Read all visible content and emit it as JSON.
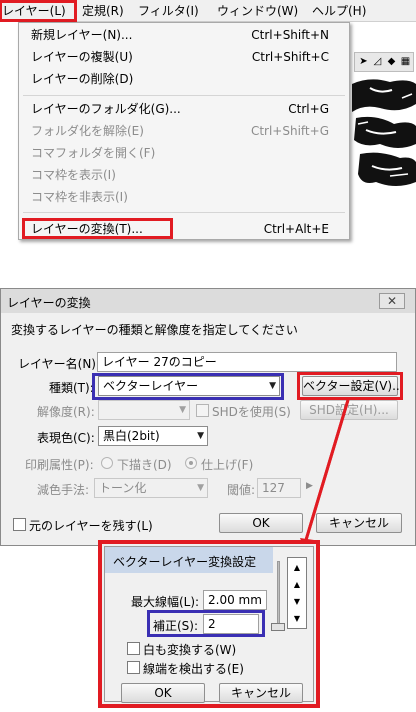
{
  "menubar": {
    "items": [
      {
        "label": "レイヤー(L)"
      },
      {
        "label": "定規(R)"
      },
      {
        "label": "フィルタ(I)"
      },
      {
        "label": "ウィンドウ(W)"
      },
      {
        "label": "ヘルプ(H)"
      }
    ]
  },
  "layer_menu": {
    "items": [
      {
        "label": "新規レイヤー(N)...",
        "shortcut": "Ctrl+Shift+N",
        "enabled": true
      },
      {
        "label": "レイヤーの複製(U)",
        "shortcut": "Ctrl+Shift+C",
        "enabled": true
      },
      {
        "label": "レイヤーの削除(D)",
        "shortcut": "",
        "enabled": true
      },
      {
        "label": "レイヤーのフォルダ化(G)...",
        "shortcut": "Ctrl+G",
        "enabled": true
      },
      {
        "label": "フォルダ化を解除(E)",
        "shortcut": "Ctrl+Shift+G",
        "enabled": false
      },
      {
        "label": "コマフォルダを開く(F)",
        "shortcut": "",
        "enabled": false
      },
      {
        "label": "コマ枠を表示(I)",
        "shortcut": "",
        "enabled": false
      },
      {
        "label": "コマ枠を非表示(I)",
        "shortcut": "",
        "enabled": false
      },
      {
        "label": "レイヤーの変換(T)...",
        "shortcut": "Ctrl+Alt+E",
        "enabled": true
      }
    ]
  },
  "convert_dialog": {
    "title": "レイヤーの変換",
    "close_label": "✕",
    "instruction": "変換するレイヤーの種類と解像度を指定してください",
    "name_label": "レイヤー名(N):",
    "name_value": "レイヤー 27のコピー",
    "type_label": "種類(T):",
    "type_value": "ベクターレイヤー",
    "vector_settings_button": "ベクター設定(V)...",
    "resolution_label": "解像度(R):",
    "resolution_value": "",
    "use_shd_label": "SHDを使用(S)",
    "shd_settings_button": "SHD設定(H)...",
    "color_label": "表現色(C):",
    "color_value": "黒白(2bit)",
    "print_label": "印刷属性(P):",
    "draft_label": "下描き(D)",
    "finish_label": "仕上げ(F)",
    "reduce_label": "減色手法:",
    "reduce_value": "トーン化",
    "threshold_label": "閾値:",
    "threshold_value": "127",
    "keep_original_label": "元のレイヤーを残す(L)",
    "ok_button": "OK",
    "cancel_button": "キャンセル"
  },
  "vector_dialog": {
    "title": "ベクターレイヤー変換設定",
    "max_width_label": "最大線幅(L):",
    "max_width_value": "2.00 mm",
    "correction_label": "補正(S):",
    "correction_value": "2",
    "convert_white_label": "白も変換する(W)",
    "detect_ends_label": "線端を検出する(E)",
    "ok_button": "OK",
    "cancel_button": "キャンセル"
  },
  "colors": {
    "highlight_red": "#e11b22",
    "highlight_blue": "#3a2fb3"
  }
}
